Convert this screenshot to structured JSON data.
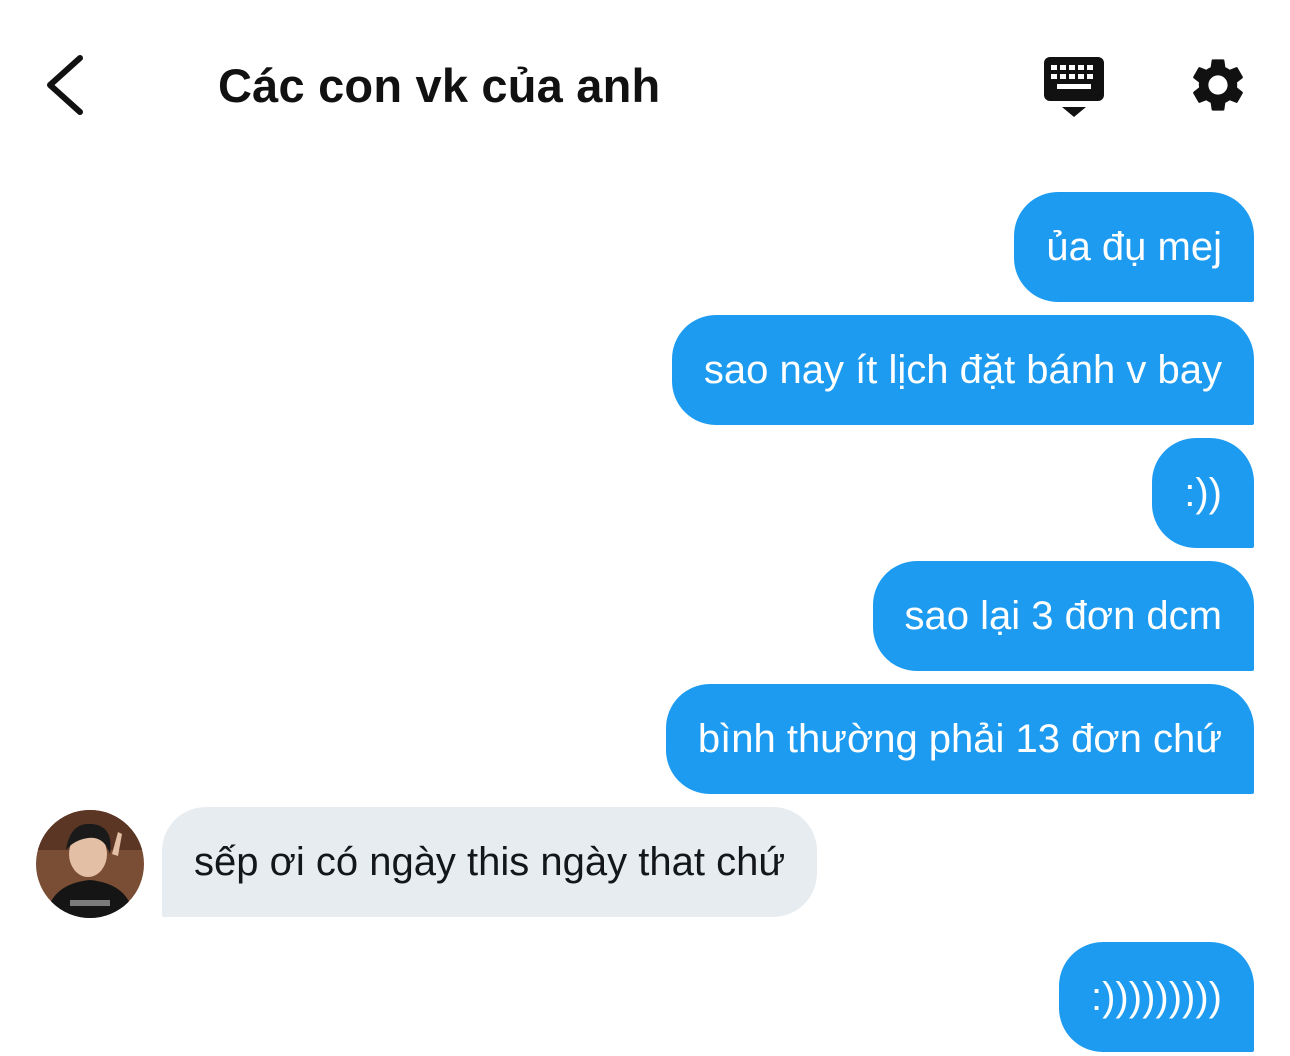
{
  "header": {
    "title": "Các con vk của anh",
    "back_icon": "chevron-left-icon",
    "keyboard_icon": "keyboard-icon",
    "settings_icon": "gear-icon"
  },
  "messages": [
    {
      "sender": "me",
      "text": "ủa đụ mej"
    },
    {
      "sender": "me",
      "text": "sao nay ít lịch đặt bánh v bay"
    },
    {
      "sender": "me",
      "text": ":))"
    },
    {
      "sender": "me",
      "text": "sao lại 3 đơn dcm"
    },
    {
      "sender": "me",
      "text": "bình thường phải 13 đơn chứ"
    },
    {
      "sender": "other",
      "text": "sếp ơi có ngày this ngày that chứ"
    },
    {
      "sender": "me",
      "text": ":)))))))))"
    }
  ],
  "colors": {
    "outgoing_bubble": "#1d9bf0",
    "incoming_bubble": "#e7ecf0"
  }
}
